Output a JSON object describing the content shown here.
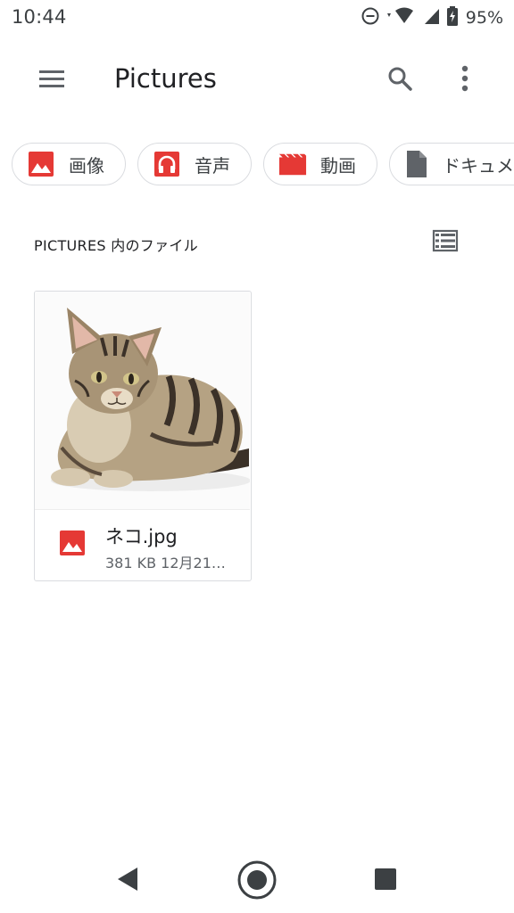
{
  "status_bar": {
    "time": "10:44",
    "battery": "95%",
    "icons": [
      "do-not-disturb-icon",
      "wifi-icon",
      "signal-icon",
      "battery-charging-icon"
    ]
  },
  "app_bar": {
    "title": "Pictures",
    "icons": [
      "menu-icon",
      "search-icon",
      "more-vert-icon"
    ]
  },
  "chips": [
    {
      "label": "画像",
      "icon": "image-icon",
      "color": "#e53935"
    },
    {
      "label": "音声",
      "icon": "headphones-icon",
      "color": "#e53935"
    },
    {
      "label": "動画",
      "icon": "movie-icon",
      "color": "#e53935"
    },
    {
      "label": "ドキュメント",
      "icon": "document-icon",
      "color": "#5f6368"
    }
  ],
  "section": {
    "header": "PICTURES 内のファイル",
    "view_icon": "list-view-icon"
  },
  "files": [
    {
      "name": "ネコ.jpg",
      "meta": "381 KB 12月21…",
      "type_icon": "image-icon",
      "thumbnail": "cat-photo"
    }
  ],
  "nav_bar": {
    "icons": [
      "back-icon",
      "home-icon",
      "recents-icon"
    ]
  },
  "colors": {
    "accent_red": "#e53935",
    "icon_gray": "#5f6368",
    "border": "#dadce0"
  }
}
